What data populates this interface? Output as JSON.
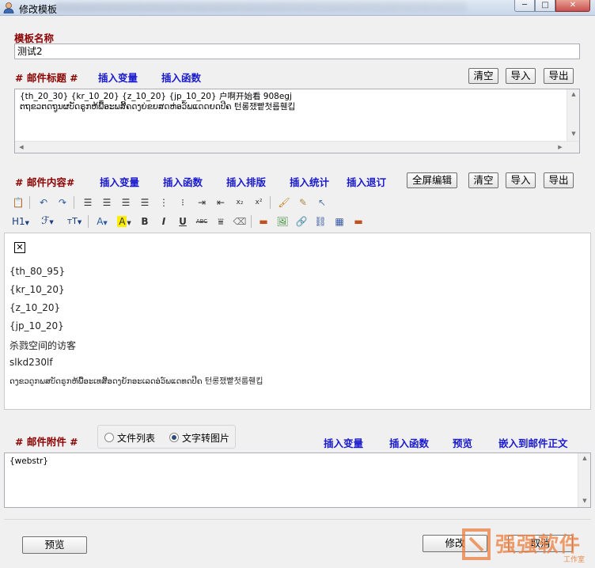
{
  "window": {
    "title": "修改模板",
    "min_glyph": "─",
    "max_glyph": "□",
    "close_glyph": "✕"
  },
  "template_name": {
    "label": "模板名称",
    "value": "测试2"
  },
  "subject": {
    "label": "# 邮件标题 #",
    "insert_var": "插入变量",
    "insert_func": "插入函数",
    "clear": "清空",
    "import": "导入",
    "export": "导出",
    "text": "{th_20_30} {kr_10_20} {z_10_20} {jp_10_20} 户啊开始看 908egj\nຕຖຂວຕດຖູນຜບັດຣູກຫ້ພື້ອະພສີ້ຄດງຍ່ຂຍສດຫ່ອວ໌ພແດດຍດປີຄ 턴롱쟀빹첫룹휀킵"
  },
  "content": {
    "label": "# 邮件内容#",
    "insert_var": "插入变量",
    "insert_func": "插入函数",
    "insert_layout": "插入排版",
    "insert_stats": "插入统计",
    "insert_unsub": "插入退订",
    "fullscreen": "全屏编辑",
    "clear": "清空",
    "import": "导入",
    "export": "导出",
    "heading_btn": "H1",
    "font_btn": "ℱ",
    "size_btn": "тT",
    "lines": [
      "{th_80_95}",
      "{kr_10_20}",
      "{z_10_20}",
      "{jp_10_20}",
      "杀戮空间的访客",
      "slkd230lf",
      "ດງຂວດູກພສບັດຣູກຫ້ພື້ອະເທສີ້ອດງຍັກອະເລດອ່ວ໌ພແດທດປີຄ 턴롱쟀빹첫룹휀킵"
    ]
  },
  "attachment": {
    "label": "# 邮件附件 #",
    "option_file_list": "文件列表",
    "option_text_to_image": "文字转图片",
    "insert_var": "插入变量",
    "insert_func": "插入函数",
    "preview": "预览",
    "embed": "嵌入到邮件正文",
    "text": "{webstr}"
  },
  "footer": {
    "preview": "预览",
    "modify": "修改",
    "cancel": "取消"
  },
  "watermark": {
    "text": "强强软件",
    "sub": "工作室"
  },
  "colors": {
    "label_red": "#8b0000",
    "label_blue": "#1a1acd",
    "watermark": "#eb7d3c"
  }
}
